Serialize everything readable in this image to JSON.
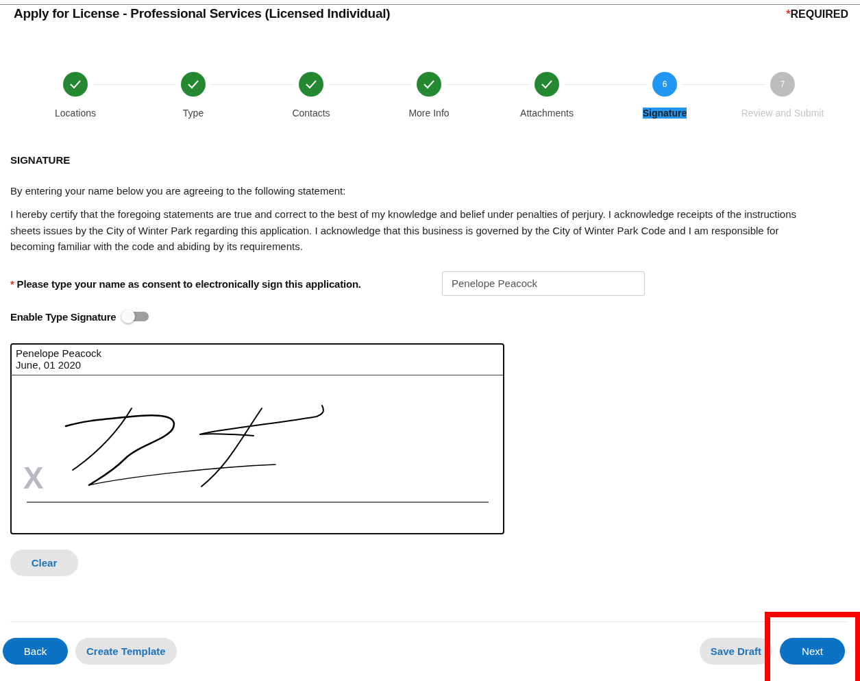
{
  "header": {
    "title": "Apply for License - Professional Services (Licensed Individual)",
    "required_mark": "*",
    "required_label": "REQUIRED"
  },
  "steps": [
    {
      "label": "Locations",
      "completed": true,
      "selected": false
    },
    {
      "label": "Type",
      "completed": true,
      "selected": false
    },
    {
      "label": "Contacts",
      "completed": true,
      "selected": false
    },
    {
      "label": "More Info",
      "completed": true,
      "selected": false
    },
    {
      "label": "Attachments",
      "completed": true,
      "selected": false
    },
    {
      "label": "Signature",
      "number": "6",
      "completed": false,
      "selected": true
    },
    {
      "label": "Review and Submit",
      "number": "7",
      "completed": false,
      "selected": false
    }
  ],
  "signature": {
    "heading": "SIGNATURE",
    "intro": "By entering your name below you are agreeing to the following statement:",
    "statement": "I hereby certify that the foregoing statements are true and correct to the best of my knowledge and belief under penalties of perjury. I acknowledge receipts of the instructions sheets issues by the City of Winter Park regarding this application. I acknowledge that this business is governed by the City of Winter Park Code and I am responsible for becoming familiar with the code and abiding by its requirements.",
    "consent_mark": "*",
    "consent_label": "Please type your name as consent to electronically sign this application.",
    "name_value": "Penelope Peacock",
    "toggle_label": "Enable Type Signature",
    "toggle_on": false,
    "pad_name": "Penelope Peacock",
    "pad_date": "June, 01 2020",
    "pad_x": "X",
    "clear_button": "Clear"
  },
  "footer": {
    "buttons": [
      {
        "label": "Back",
        "kind": "primary",
        "highlighted": false
      },
      {
        "label": "Create Template",
        "kind": "secondary",
        "highlighted": false
      },
      {
        "label": "Save Draft",
        "kind": "secondary",
        "highlighted": false
      },
      {
        "label": "Next",
        "kind": "primary",
        "highlighted": true
      }
    ]
  }
}
